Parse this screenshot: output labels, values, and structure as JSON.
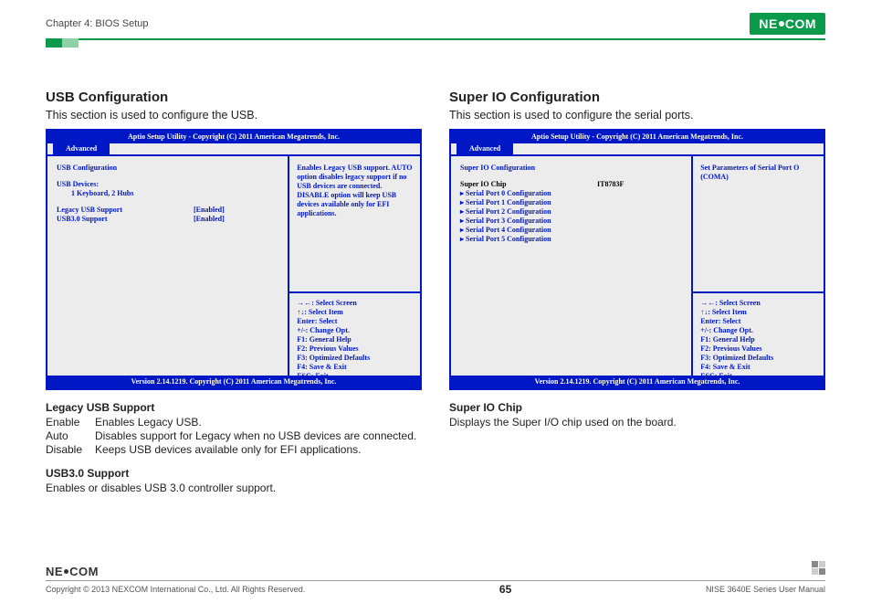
{
  "header": {
    "chapter": "Chapter 4: BIOS Setup",
    "brand": "NE COM"
  },
  "left": {
    "title": "USB Configuration",
    "lead": "This section is used to configure the USB.",
    "bios": {
      "title": "Aptio Setup Utility - Copyright (C) 2011 American Megatrends, Inc.",
      "tab": "Advanced",
      "heading": "USB Configuration",
      "devices_label": "USB Devices:",
      "devices_value": "1 Keyboard, 2 Hubs",
      "rows": [
        {
          "label": "Legacy USB Support",
          "value": "[Enabled]"
        },
        {
          "label": "USB3.0 Support",
          "value": "[Enabled]"
        }
      ],
      "help": "Enables Legacy USB support. AUTO option disables legacy support if no USB devices are connected. DISABLE option will keep USB devices available only for EFI applications.",
      "keys": [
        "→←: Select Screen",
        "↑↓: Select Item",
        "Enter: Select",
        "+/-: Change Opt.",
        "F1: General Help",
        "F2: Previous Values",
        "F3: Optimized Defaults",
        "F4: Save & Exit",
        "ESC: Exit"
      ],
      "footer": "Version 2.14.1219. Copyright (C) 2011 American Megatrends, Inc."
    },
    "sub1_title": "Legacy USB Support",
    "defs": [
      {
        "term": "Enable",
        "desc": "Enables Legacy USB."
      },
      {
        "term": "Auto",
        "desc": "Disables support for Legacy when no USB devices are connected."
      },
      {
        "term": "Disable",
        "desc": "Keeps USB devices available only for EFI applications."
      }
    ],
    "sub2_title": "USB3.0 Support",
    "sub2_text": "Enables or disables USB 3.0 controller support."
  },
  "right": {
    "title": "Super IO Configuration",
    "lead": "This section is used to configure the serial ports.",
    "bios": {
      "title": "Aptio Setup Utility - Copyright (C) 2011 American Megatrends, Inc.",
      "tab": "Advanced",
      "heading": "Super IO Configuration",
      "chip_label": "Super IO Chip",
      "chip_value": "IT8783F",
      "ports": [
        "Serial Port 0 Configuration",
        "Serial Port 1 Configuration",
        "Serial Port 2 Configuration",
        "Serial Port 3 Configuration",
        "Serial Port 4 Configuration",
        "Serial Port 5 Configuration"
      ],
      "help": "Set Parameters of Serial Port O (COMA)",
      "keys": [
        "→←: Select Screen",
        "↑↓: Select Item",
        "Enter: Select",
        "+/-: Change Opt.",
        "F1: General Help",
        "F2: Previous Values",
        "F3: Optimized Defaults",
        "F4: Save & Exit",
        "ESC: Exit"
      ],
      "footer": "Version 2.14.1219. Copyright (C) 2011 American Megatrends, Inc."
    },
    "sub1_title": "Super IO Chip",
    "sub1_text": "Displays the Super I/O chip used on the board."
  },
  "footer": {
    "brand": "NE COM",
    "copyright": "Copyright © 2013 NEXCOM International Co., Ltd. All Rights Reserved.",
    "page": "65",
    "manual": "NISE 3640E Series User Manual"
  }
}
